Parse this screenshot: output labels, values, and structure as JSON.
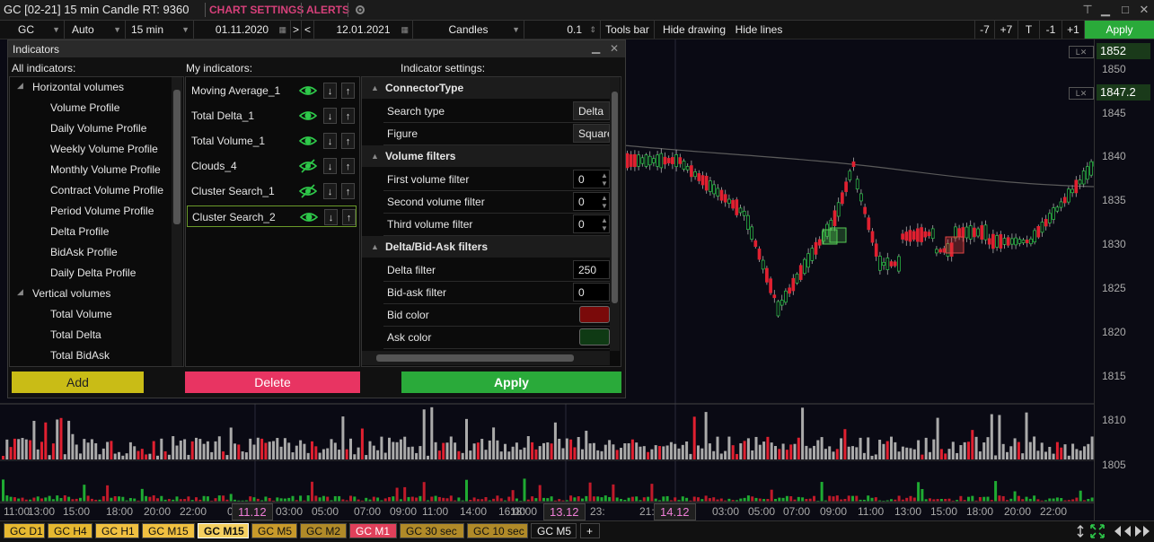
{
  "window": {
    "title": "GC [02-21] 15 min Candle RT: 9360",
    "chart_settings": "CHART SETTINGS",
    "alerts": "ALERTS"
  },
  "toolbar": {
    "symbol": "GC",
    "scale": "Auto",
    "timeframe": "15 min",
    "date_from": "01.11.2020",
    "nav_forward": ">",
    "nav_back": "<",
    "date_to": "12.01.2021",
    "chart_type": "Candles",
    "tick": "0.1",
    "tools_bar": "Tools bar",
    "hide_drawing": "Hide drawing",
    "hide_lines": "Hide lines",
    "minus7": "-7",
    "plus7": "+7",
    "t": "T",
    "minus1": "-1",
    "plus1": "+1",
    "apply": "Apply"
  },
  "price_axis": {
    "current_price": "1852",
    "marker_price": "1847.2",
    "labels": [
      "1850",
      "1845",
      "1840",
      "1835",
      "1830",
      "1825",
      "1820",
      "1815",
      "1810",
      "1805"
    ]
  },
  "time_axis": {
    "labels": [
      "11:00",
      "13:00",
      "15:00",
      "18:00",
      "20:00",
      "22:00",
      "01:00",
      "03:00",
      "05:00",
      "07:00",
      "09:00",
      "11:00",
      "14:00",
      "16:00",
      "18:00",
      "20:00",
      "23:",
      "21:00",
      "23:",
      "03:00",
      "05:00",
      "07:00",
      "09:00",
      "11:00",
      "13:00",
      "15:00",
      "18:00",
      "20:00",
      "22:00"
    ],
    "day_labels": [
      "11.12",
      "13.12",
      "14.12"
    ]
  },
  "tabs": [
    {
      "label": "GC D1",
      "color": "#e6b830"
    },
    {
      "label": "GC H4",
      "color": "#e6b830"
    },
    {
      "label": "GC H1",
      "color": "#f0c040"
    },
    {
      "label": "GC M15",
      "color": "#f0c040"
    },
    {
      "label": "GC M15",
      "color": "#f5d060"
    },
    {
      "label": "GC M5",
      "color": "#c89a2a"
    },
    {
      "label": "GC M2",
      "color": "#b08a28"
    },
    {
      "label": "GC M1",
      "color": "#e0405a"
    },
    {
      "label": "GC 30 sec",
      "color": "#b08a28"
    },
    {
      "label": "GC 10 sec",
      "color": "#b08a28"
    },
    {
      "label": "GC M5",
      "color": "#111111"
    },
    {
      "label": "+",
      "color": "#111111"
    }
  ],
  "dialog": {
    "title": "Indicators",
    "all_header": "All indicators:",
    "my_header": "My indicators:",
    "settings_header": "Indicator settings:",
    "tree": [
      {
        "label": "Horizontal volumes",
        "group": true
      },
      {
        "label": "Volume Profile",
        "group": false
      },
      {
        "label": "Daily Volume Profile",
        "group": false
      },
      {
        "label": "Weekly Volume Profile",
        "group": false
      },
      {
        "label": "Monthly Volume Profile",
        "group": false
      },
      {
        "label": "Contract Volume Profile",
        "group": false
      },
      {
        "label": "Period Volume Profile",
        "group": false
      },
      {
        "label": "Delta Profile",
        "group": false
      },
      {
        "label": "BidAsk Profile",
        "group": false
      },
      {
        "label": "Daily Delta Profile",
        "group": false
      },
      {
        "label": "Vertical volumes",
        "group": true
      },
      {
        "label": "Total Volume",
        "group": false
      },
      {
        "label": "Total Delta",
        "group": false
      },
      {
        "label": "Total BidAsk",
        "group": false
      }
    ],
    "my_indicators": [
      {
        "label": "Moving Average_1",
        "hidden": false
      },
      {
        "label": "Total Delta_1",
        "hidden": false
      },
      {
        "label": "Total Volume_1",
        "hidden": false
      },
      {
        "label": "Clouds_4",
        "hidden": true
      },
      {
        "label": "Cluster Search_1",
        "hidden": true
      },
      {
        "label": "Cluster Search_2",
        "hidden": false
      }
    ],
    "sections": [
      {
        "title": "ConnectorType",
        "rows": [
          {
            "label": "Search type",
            "value": "Delta"
          },
          {
            "label": "Figure",
            "value": "Square"
          }
        ]
      },
      {
        "title": "Volume filters",
        "rows": [
          {
            "label": "First volume filter",
            "value": "0"
          },
          {
            "label": "Second volume filter",
            "value": "0"
          },
          {
            "label": "Third volume filter",
            "value": "0"
          }
        ]
      },
      {
        "title": "Delta/Bid-Ask filters",
        "rows": [
          {
            "label": "Delta filter",
            "value": "250"
          },
          {
            "label": "Bid-ask filter",
            "value": "0"
          },
          {
            "label": "Bid color",
            "value": ""
          },
          {
            "label": "Ask color",
            "value": ""
          }
        ]
      }
    ],
    "bid_color": "#7a0a0a",
    "ask_color": "#0f3a14",
    "add_label": "Add",
    "delete_label": "Delete",
    "apply_label": "Apply"
  }
}
